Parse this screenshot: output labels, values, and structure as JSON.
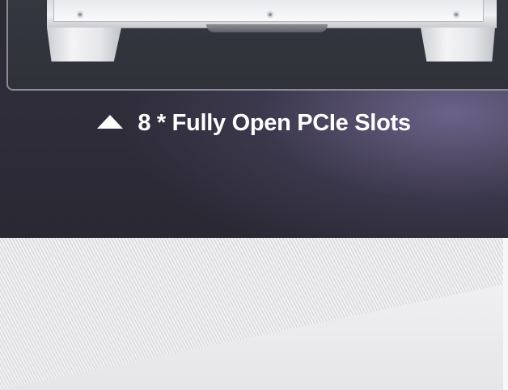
{
  "caption": {
    "icon": "triangle-up-icon",
    "text": "8 * Fully Open PCIe Slots"
  },
  "colors": {
    "panel_dark": "#2b2b34",
    "panel_glow": "#766c96",
    "caption_text": "#ffffff",
    "floor_light": "#f0f0f2",
    "floor_stripe": "#d6d6d9"
  }
}
